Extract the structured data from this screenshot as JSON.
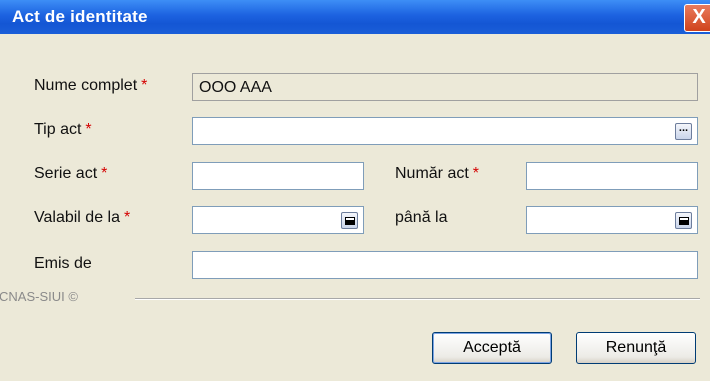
{
  "window": {
    "title": "Act de identitate",
    "close_glyph": "X"
  },
  "form": {
    "nume": {
      "label": "Nume complet",
      "required_mark": "*",
      "value": "OOO AAA"
    },
    "tip_act": {
      "label": "Tip act",
      "required_mark": "*",
      "value": "",
      "button_glyph": "..."
    },
    "serie": {
      "label": "Serie act",
      "required_mark": "*",
      "value": ""
    },
    "numar": {
      "label": "Număr act",
      "required_mark": "*",
      "value": ""
    },
    "valabil": {
      "label": "Valabil de la",
      "required_mark": "*",
      "value": ""
    },
    "pana": {
      "label": "până la",
      "value": ""
    },
    "emis": {
      "label": "Emis de",
      "value": ""
    }
  },
  "footer": {
    "copyright": "CNAS-SIUI ©",
    "accept_label": "Acceptă",
    "cancel_label": "Renunţă"
  },
  "icons": {
    "calendar": "calendar-icon",
    "ellipsis": "ellipsis-icon",
    "close": "close-icon"
  }
}
